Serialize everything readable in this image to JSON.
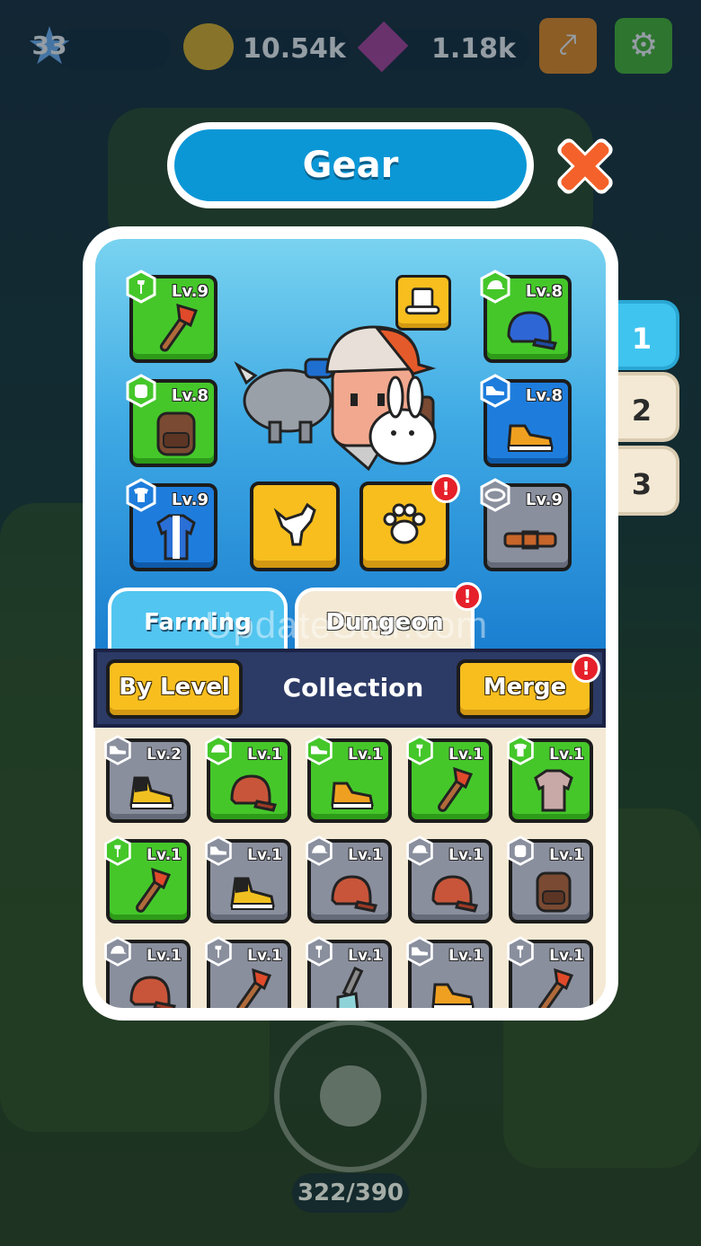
{
  "hud": {
    "level": "33",
    "coins": "10.54k",
    "gems": "1.18k"
  },
  "bottom": {
    "counter": "322/390"
  },
  "title": "Gear",
  "slot_tabs": [
    {
      "label": "1",
      "active": true
    },
    {
      "label": "2",
      "active": false
    },
    {
      "label": "3",
      "active": false
    }
  ],
  "equipped": {
    "axe": {
      "level": "Lv.9",
      "rarity": "green",
      "icon": "axe-icon"
    },
    "backpack": {
      "level": "Lv.8",
      "rarity": "green",
      "icon": "backpack-icon"
    },
    "shirt": {
      "level": "Lv.9",
      "rarity": "blue",
      "icon": "shirt-icon"
    },
    "cap": {
      "level": "Lv.8",
      "rarity": "green",
      "icon": "cap-icon"
    },
    "shoes": {
      "level": "Lv.8",
      "rarity": "blue",
      "icon": "shoe-icon"
    },
    "belt": {
      "level": "Lv.9",
      "rarity": "grey",
      "icon": "belt-icon"
    }
  },
  "mode_tabs": {
    "farming": "Farming",
    "dungeon": "Dungeon"
  },
  "toolbar": {
    "by_level": "By Level",
    "collection": "Collection",
    "merge": "Merge"
  },
  "watermark": "UpdateStar.com",
  "collection": [
    {
      "level": "Lv.2",
      "rarity": "grey",
      "icon": "sneaker-icon",
      "slot": "shoe"
    },
    {
      "level": "Lv.1",
      "rarity": "green",
      "icon": "cap-icon",
      "slot": "hat"
    },
    {
      "level": "Lv.1",
      "rarity": "green",
      "icon": "shoe-icon",
      "slot": "shoe"
    },
    {
      "level": "Lv.1",
      "rarity": "green",
      "icon": "axe-icon",
      "slot": "tool"
    },
    {
      "level": "Lv.1",
      "rarity": "green",
      "icon": "shirt-icon",
      "slot": "shirt"
    },
    {
      "level": "Lv.1",
      "rarity": "green",
      "icon": "axe-icon",
      "slot": "tool"
    },
    {
      "level": "Lv.1",
      "rarity": "grey",
      "icon": "sneaker-icon",
      "slot": "shoe"
    },
    {
      "level": "Lv.1",
      "rarity": "grey",
      "icon": "cap-icon",
      "slot": "hat"
    },
    {
      "level": "Lv.1",
      "rarity": "grey",
      "icon": "cap-icon",
      "slot": "hat"
    },
    {
      "level": "Lv.1",
      "rarity": "grey",
      "icon": "backpack-icon",
      "slot": "backpack"
    },
    {
      "level": "Lv.1",
      "rarity": "grey",
      "icon": "cap-icon",
      "slot": "hat"
    },
    {
      "level": "Lv.1",
      "rarity": "grey",
      "icon": "axe-icon",
      "slot": "tool"
    },
    {
      "level": "Lv.1",
      "rarity": "grey",
      "icon": "shovel-icon",
      "slot": "tool"
    },
    {
      "level": "Lv.1",
      "rarity": "grey",
      "icon": "shoe-icon",
      "slot": "shoe"
    },
    {
      "level": "Lv.1",
      "rarity": "grey",
      "icon": "axe-icon",
      "slot": "tool"
    }
  ],
  "colors": {
    "accent_blue": "#0b97d6",
    "rarity_green": "#45c72a",
    "rarity_blue": "#1e7ddc",
    "rarity_grey": "#8a8f9e",
    "button_yellow": "#f7be1e",
    "alert_red": "#e6202a",
    "close_orange": "#f5612a"
  }
}
